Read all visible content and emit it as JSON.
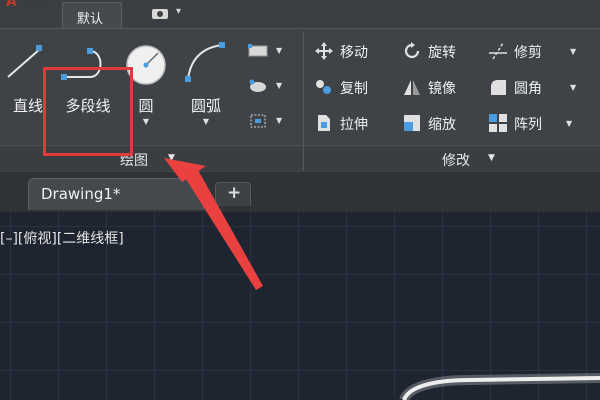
{
  "top_bar": {
    "active_tab": "默认"
  },
  "draw_panel": {
    "title": "绘图",
    "tools": [
      {
        "label": "直线"
      },
      {
        "label": "多段线"
      },
      {
        "label": "圆"
      },
      {
        "label": "圆弧"
      }
    ]
  },
  "modify_panel": {
    "title": "修改",
    "tools": [
      {
        "label": "移动"
      },
      {
        "label": "旋转"
      },
      {
        "label": "修剪"
      },
      {
        "label": "复制"
      },
      {
        "label": "镜像"
      },
      {
        "label": "圆角"
      },
      {
        "label": "拉伸"
      },
      {
        "label": "缩放"
      },
      {
        "label": "阵列"
      }
    ]
  },
  "document_tabs": {
    "active": "Drawing1*",
    "add_label": "+"
  },
  "canvas": {
    "viewport_label": "[–][俯视][二维线框]"
  },
  "colors": {
    "highlight": "#e03a3a",
    "accent_icon": "#4a9be0"
  }
}
